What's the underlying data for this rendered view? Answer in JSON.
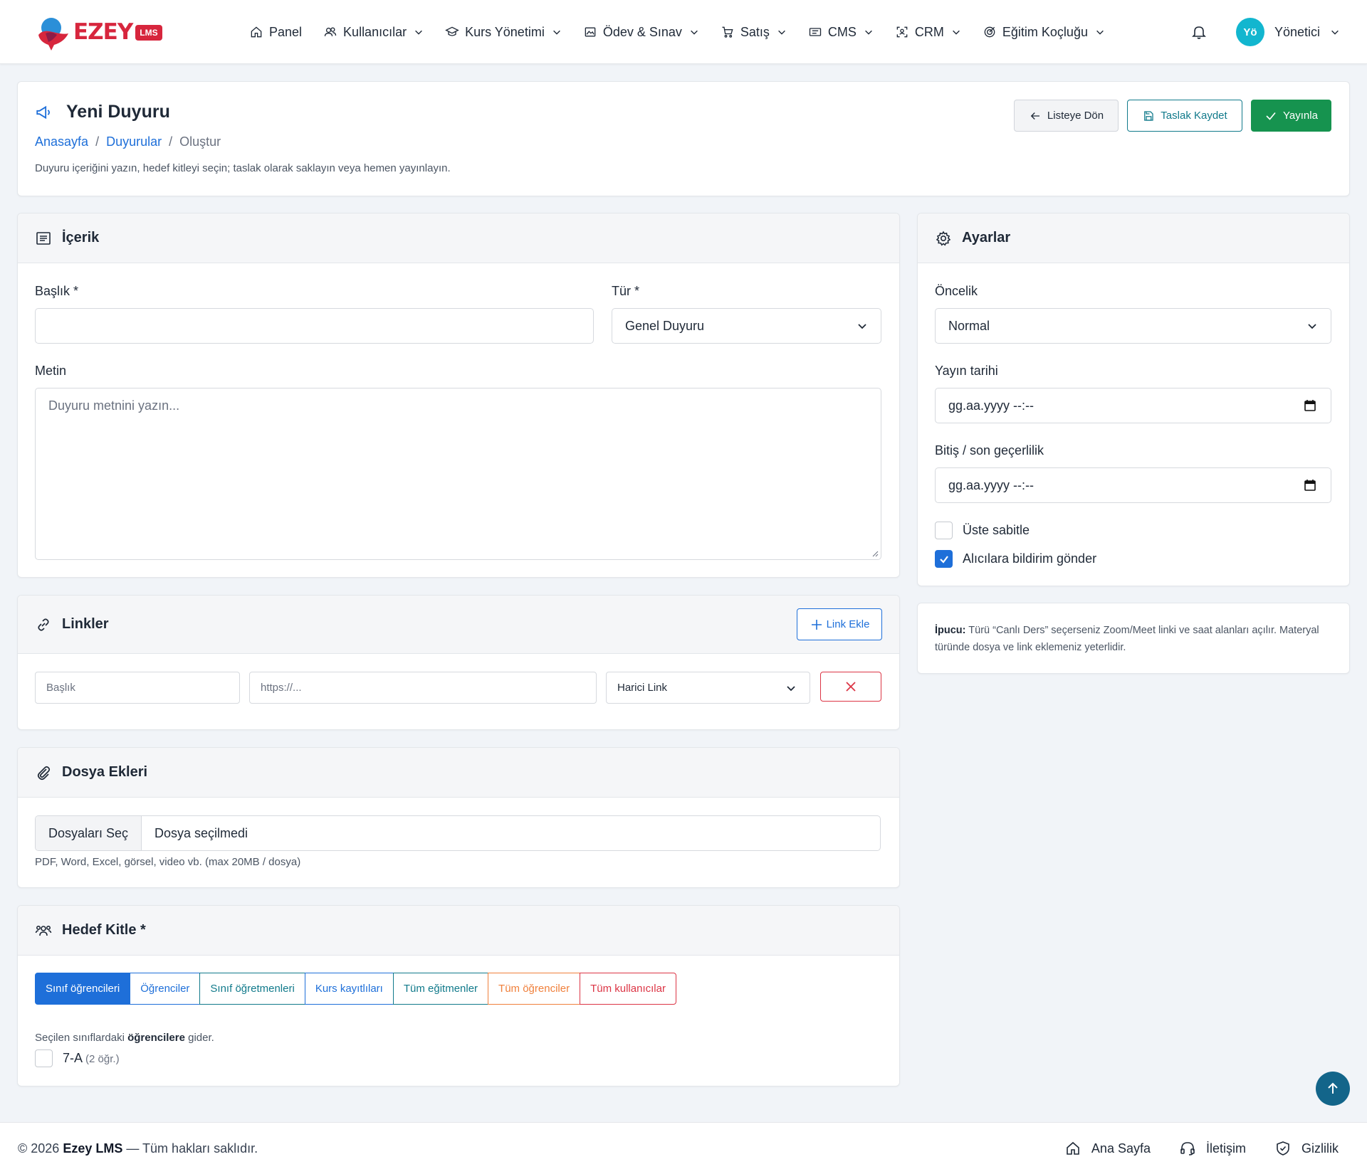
{
  "app": {
    "logo_text": "EZEY",
    "logo_badge": "LMS"
  },
  "nav": {
    "items": [
      {
        "label": "Panel",
        "icon": "home-icon"
      },
      {
        "label": "Kullanıcılar",
        "icon": "users-icon"
      },
      {
        "label": "Kurs Yönetimi",
        "icon": "graduation-cap-icon"
      },
      {
        "label": "Ödev & Sınav",
        "icon": "image-icon"
      },
      {
        "label": "Satış",
        "icon": "cart-icon"
      },
      {
        "label": "CMS",
        "icon": "newspaper-icon"
      },
      {
        "label": "CRM",
        "icon": "contact-icon"
      },
      {
        "label": "Eğitim Koçluğu",
        "icon": "target-icon"
      }
    ],
    "user": {
      "initials": "Yö",
      "name": "Yönetici"
    }
  },
  "header": {
    "title": "Yeni Duyuru",
    "breadcrumb": {
      "home": "Anasayfa",
      "section": "Duyurular",
      "current": "Oluştur",
      "separator": "/"
    },
    "description": "Duyuru içeriğini yazın, hedef kitleyi seçin; taslak olarak saklayın veya hemen yayınlayın.",
    "buttons": {
      "back": "Listeye Dön",
      "draft": "Taslak Kaydet",
      "publish": "Yayınla"
    }
  },
  "content": {
    "title": "İçerik",
    "title_label": "Başlık *",
    "title_value": "",
    "type_label": "Tür *",
    "type_value": "Genel Duyuru",
    "body_label": "Metin",
    "body_placeholder": "Duyuru metnini yazın..."
  },
  "settings": {
    "title": "Ayarlar",
    "priority_label": "Öncelik",
    "priority_value": "Normal",
    "publish_date_label": "Yayın tarihi",
    "publish_date_value": "gg.aa.yyyy --:--",
    "end_date_label": "Bitiş / son geçerlilik",
    "end_date_value": "gg.aa.yyyy --:--",
    "pin_label": "Üste sabitle",
    "pin_checked": false,
    "notify_label": "Alıcılara bildirim gönder",
    "notify_checked": true
  },
  "tip": {
    "bold": "İpucu:",
    "text": "Türü “Canlı Ders” seçerseniz Zoom/Meet linki ve saat alanları açılır. Materyal türünde dosya ve link eklemeniz yeterlidir."
  },
  "links": {
    "title": "Linkler",
    "add_button": "Link Ekle",
    "row": {
      "title_placeholder": "Başlık",
      "url_placeholder": "https://...",
      "type_value": "Harici Link"
    }
  },
  "attachments": {
    "title": "Dosya Ekleri",
    "choose_button": "Dosyaları Seç",
    "file_status": "Dosya seçilmedi",
    "help": "PDF, Word, Excel, görsel, video vb. (max 20MB / dosya)"
  },
  "audience": {
    "title": "Hedef Kitle *",
    "options": [
      {
        "label": "Sınıf öğrencileri",
        "color": "#1e6fd9",
        "active": true
      },
      {
        "label": "Öğrenciler",
        "color": "#1e6fd9",
        "active": false
      },
      {
        "label": "Sınıf öğretmenleri",
        "color": "#117a8b",
        "active": false
      },
      {
        "label": "Kurs kayıtlıları",
        "color": "#1e6fd9",
        "active": false
      },
      {
        "label": "Tüm eğitmenler",
        "color": "#117a8b",
        "active": false
      },
      {
        "label": "Tüm öğrenciler",
        "color": "#f0803c",
        "active": false
      },
      {
        "label": "Tüm kullanıcılar",
        "color": "#dc3545",
        "active": false
      }
    ],
    "hint_pre": "Seçilen sınıflardaki",
    "hint_bold": "öğrencilere",
    "hint_post": "gider.",
    "classes": [
      {
        "name": "7-A",
        "count": "(2 öğr.)",
        "checked": false
      }
    ]
  },
  "footer": {
    "copyright_pre": "© 2026",
    "brand": "Ezey LMS",
    "copyright_post": "— Tüm hakları saklıdır.",
    "links": [
      {
        "label": "Ana Sayfa",
        "icon": "home-icon"
      },
      {
        "label": "İletişim",
        "icon": "headset-icon"
      },
      {
        "label": "Gizlilik",
        "icon": "shield-check-icon"
      }
    ]
  },
  "colors": {
    "primary": "#1e6fd9",
    "success": "#16934f",
    "info": "#117a8b",
    "danger": "#dc3545",
    "warning": "#f0803c",
    "brand": "#d7263d",
    "scroll_top": "#13658a"
  }
}
